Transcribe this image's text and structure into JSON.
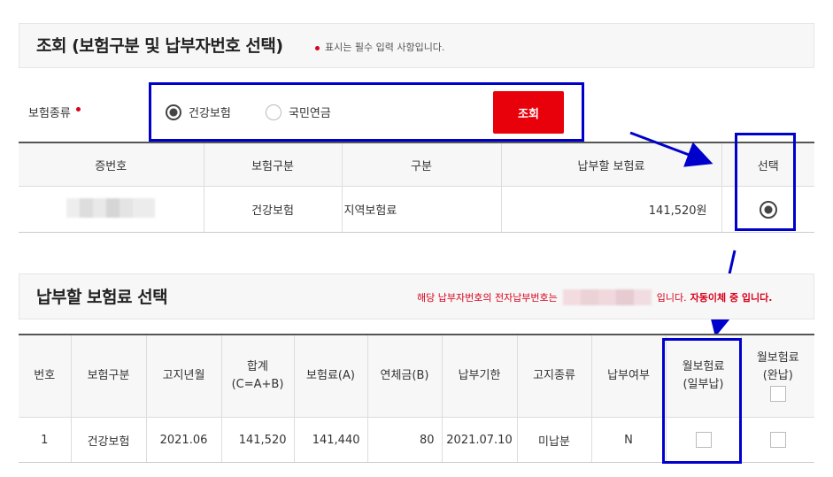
{
  "search_section": {
    "title": "조회 (보험구분 및 납부자번호 선택)",
    "required_note": "표시는 필수 입력 사항입니다.",
    "insurance_type_label": "보험종류",
    "options": [
      "건강보험",
      "국민연금"
    ],
    "selected_option": "건강보험",
    "search_button": "조회"
  },
  "payer_table": {
    "headers": [
      "증번호",
      "보험구분",
      "구분",
      "납부할 보험료",
      "선택"
    ],
    "rows": [
      {
        "card_no": "",
        "insurance": "건강보험",
        "category": "지역보험료",
        "amount": "141,520원",
        "selected": true
      }
    ]
  },
  "premium_section": {
    "title": "납부할 보험료 선택",
    "notice_prefix": "해당 납부자번호의 전자납부번호는",
    "notice_suffix": "입니다.",
    "notice_bold": "자동이체 중 입니다."
  },
  "premium_table": {
    "headers": [
      "번호",
      "보험구분",
      "고지년월",
      "합계",
      "(C=A+B)",
      "보험료(A)",
      "연체금(B)",
      "납부기한",
      "고지종류",
      "납부여부",
      "월보험료",
      "(일부납)",
      "월보험료",
      "(완납)"
    ],
    "rows": [
      {
        "no": "1",
        "insurance": "건강보험",
        "month": "2021.06",
        "total": "141,520",
        "premium": "141,440",
        "overdue": "80",
        "due": "2021.07.10",
        "kind": "미납분",
        "paid": "N"
      }
    ]
  },
  "colors": {
    "accent_red": "#e8000b",
    "annotation_blue": "#0000cc"
  }
}
